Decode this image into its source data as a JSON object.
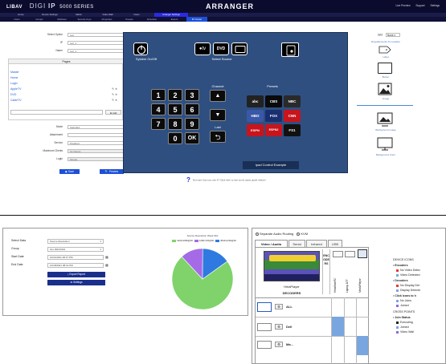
{
  "arranger": {
    "brand": {
      "company": "LIBAV",
      "product": "DIGI",
      "product2": "IP",
      "series": "5000 SERIES"
    },
    "app_title": "ARRANGER",
    "top_right": [
      "Live Preview",
      "Support",
      "Settings"
    ],
    "menu": [
      "Home",
      "Device Settings",
      "Matrix",
      "Video Wall",
      "Users",
      "Arranger Settings"
    ],
    "menu_active": 5,
    "submenu": [
      "Users",
      "Groups",
      "Multicast",
      "Security Keys",
      "Properties",
      "Presets",
      "Scheduler",
      "Events",
      "IR Cluster"
    ],
    "submenu_active": 8,
    "form": {
      "select_option_label": "Select Option",
      "select_option_value": "test",
      "ip_label": "IP",
      "ip_value": "test_1",
      "name_label": "Name",
      "name_value": "test_1"
    },
    "pages": {
      "header": "Pages",
      "items": [
        "Master",
        "Home",
        "Login",
        "AppleTV",
        "DVD",
        "CableTV"
      ],
      "add_label": "Add"
    },
    "form2": {
      "mode_label": "Mode",
      "mode_value": "Standard",
      "attachment_label": "Attachment",
      "attachment_value": "",
      "service_label": "Service",
      "service_value": "Disabled",
      "maximum_clients_label": "Maximum Clients",
      "maximum_clients_value": "10 Clients",
      "login_label": "Login",
      "login_value": "Simple"
    },
    "buttons": {
      "save": "Save",
      "preview": "Preview"
    },
    "stage": {
      "system_on_off": "System On/Off",
      "select_source": "Select Source",
      "channel": "Channel",
      "presets": "Presets",
      "last": "Last",
      "keys": [
        "1",
        "2",
        "3",
        "4",
        "5",
        "6",
        "7",
        "8",
        "9",
        "0",
        "OK"
      ],
      "preset_logos": [
        "abc",
        "CBS",
        "NBC",
        "HBO",
        "FOX",
        "CNN",
        "ESPN",
        "ESPN2",
        "FS1"
      ],
      "source_apple": "tv",
      "source_dvd": "DVD",
      "ipad_label": "Ipad Control Example"
    },
    "help_text": "Not sure how you use it? Click here to see some quick guide videos!",
    "right_panel": {
      "grid_label": "Grid",
      "grid_value": "None",
      "drag_title": "Drag Elements To Location",
      "elements": [
        "Label",
        "Button",
        "Image",
        "Background Image",
        "Background Color"
      ]
    }
  },
  "report": {
    "fields": [
      {
        "label": "Select Data",
        "value": "Source Resolution"
      },
      {
        "label": "Group",
        "value": "ALL DEVICES"
      },
      {
        "label": "Start Date",
        "value": "10/11/2021 08:27 PM"
      },
      {
        "label": "End Date",
        "value": "10/18/2021 08:19 PM"
      }
    ],
    "export_label": "Export Report",
    "settings_label": "Settings"
  },
  "chart_data": {
    "type": "pie",
    "title": "Source Resolution Week Wis",
    "series": [
      {
        "name": "1920x1080@60",
        "value": 73,
        "color": "#7fd36a"
      },
      {
        "name": "1280x720@60",
        "value": 12,
        "color": "#a56ae6"
      },
      {
        "name": "3840x2160@30",
        "value": 15,
        "color": "#2f7ae0"
      }
    ],
    "legend_position": "top"
  },
  "crosspoint": {
    "radio_separate_audio": "Separate Audio Routing",
    "radio_kvm": "KVM",
    "tabs": [
      "Video / Audio",
      "Serial",
      "Infrared",
      "USB"
    ],
    "encoders_vertical": "ENCODERS",
    "encoder_names": [
      "HelaMateRC",
      "Laptop 1ET",
      "MediaPlayer"
    ],
    "helaplayer": "HelaPlayer",
    "decoders_label": "DECODERS",
    "decoder_rows": [
      "ALL",
      "Dell",
      "Ma..."
    ],
    "legend": {
      "device_icons": "DEVICE ICONS",
      "encoders": "Encoders",
      "no_video_detected": "No Video Detec",
      "video_detected": "Video Detected",
      "decoders": "Decoders",
      "no_display_detected": "No Display Det",
      "display_detected": "Display Detecte",
      "click_icons": "Click icons to h",
      "no_joins": "No Joins",
      "joined": "Joined",
      "cross_points": "CROSS POINTS",
      "join_status": "Join Status",
      "executing": "Executing",
      "joined2": "Joined",
      "video_wall": "Video Wall"
    },
    "colors": {
      "red": "#e53935",
      "blue": "#7aa6e0",
      "dark": "#222222",
      "purple": "#8e6ad6"
    }
  }
}
